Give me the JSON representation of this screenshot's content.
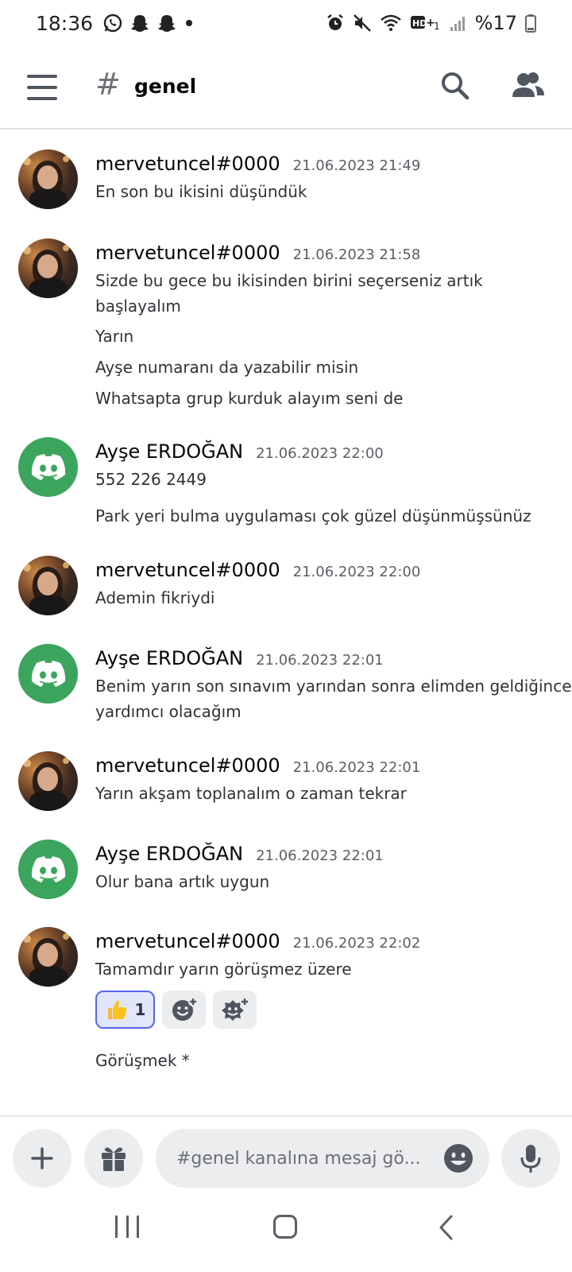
{
  "status_bar": {
    "time": "18:36",
    "battery": "%17",
    "left_icons": [
      "whatsapp-icon",
      "snapchat-icon",
      "snapchat-icon",
      "dot-icon"
    ],
    "right_icons": [
      "alarm-icon",
      "mute-icon",
      "wifi-icon",
      "hd-signal-icon",
      "cell-signal-icon",
      "battery-icon"
    ]
  },
  "header": {
    "channel_name": "genel",
    "hash": "#"
  },
  "messages": [
    {
      "user": "mervetuncel#0000",
      "time": "21.06.2023 21:49",
      "avatar": "photo",
      "lines": [
        "En son bu ikisini düşündük"
      ]
    },
    {
      "user": "mervetuncel#0000",
      "time": "21.06.2023 21:58",
      "avatar": "photo",
      "lines": [
        "Sizde bu gece bu ikisinden birini seçerseniz artık",
        "başlayalım",
        "Yarın",
        "Ayşe numaranı da yazabilir misin",
        "Whatsapta grup kurduk alayım seni de"
      ]
    },
    {
      "user": "Ayşe ERDOĞAN",
      "time": "21.06.2023 22:00",
      "avatar": "discord",
      "lines": [
        "552 226 2449",
        "Park yeri bulma uygulaması çok güzel düşünmüşsünüz"
      ]
    },
    {
      "user": "mervetuncel#0000",
      "time": "21.06.2023 22:00",
      "avatar": "photo",
      "lines": [
        "Ademin fikriydi"
      ]
    },
    {
      "user": "Ayşe ERDOĞAN",
      "time": "21.06.2023 22:01",
      "avatar": "discord",
      "lines": [
        "Benim yarın son sınavım yarından sonra elimden geldiğince",
        "yardımcı olacağım"
      ]
    },
    {
      "user": "mervetuncel#0000",
      "time": "21.06.2023 22:01",
      "avatar": "photo",
      "lines": [
        "Yarın akşam toplanalım o zaman tekrar"
      ]
    },
    {
      "user": "Ayşe ERDOĞAN",
      "time": "21.06.2023 22:01",
      "avatar": "discord",
      "lines": [
        "Olur bana artık uygun"
      ]
    },
    {
      "user": "mervetuncel#0000",
      "time": "21.06.2023 22:02",
      "avatar": "photo",
      "lines": [
        "Tamamdır yarın görüşmez üzere",
        "Görüşmek *"
      ],
      "reactions": {
        "thumbs_up_count": "1",
        "icons": [
          "thumbs-up-icon",
          "add-reaction-icon",
          "add-super-reaction-icon"
        ]
      }
    }
  ],
  "input": {
    "placeholder": "#genel kanalına mesaj gö..."
  },
  "colors": {
    "discord_green": "#3ba55d",
    "blurple": "#5865f2"
  }
}
